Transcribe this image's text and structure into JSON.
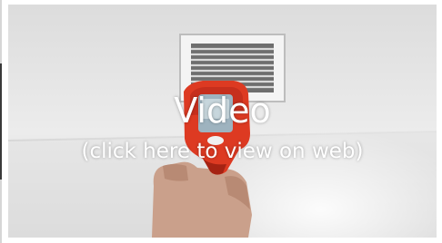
{
  "video": {
    "title": "Video",
    "subtitle": "(click here to view on web)"
  }
}
